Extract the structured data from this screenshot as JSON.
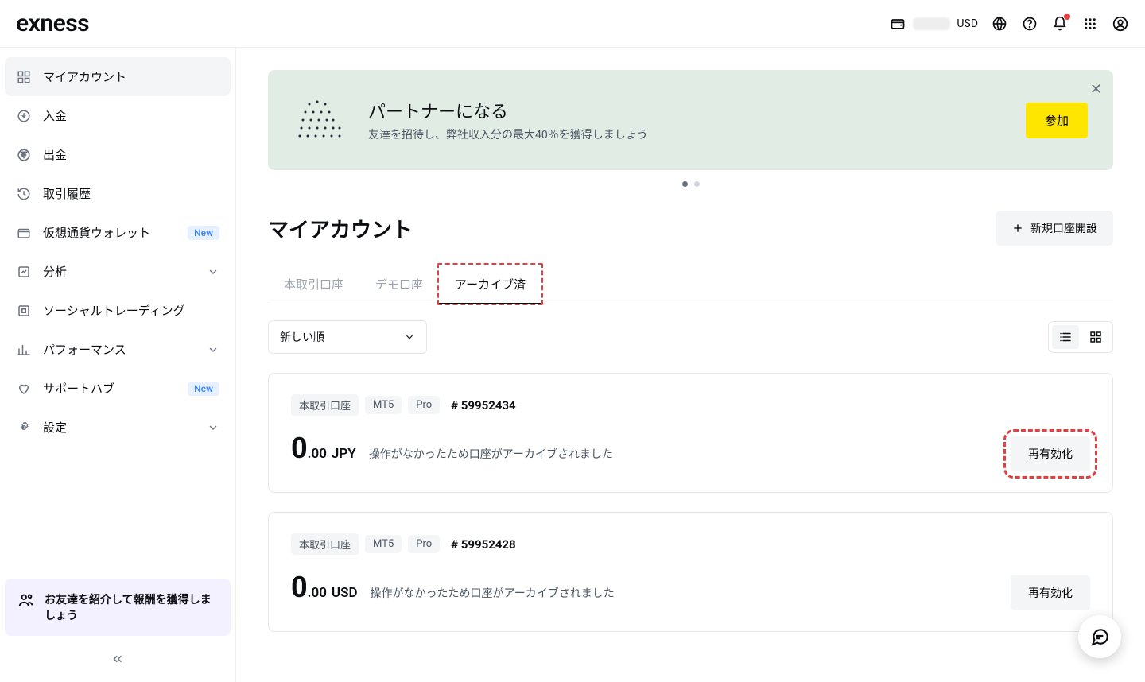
{
  "brand": "exness",
  "header": {
    "currency": "USD"
  },
  "sidebar": {
    "items": [
      {
        "label": "マイアカウント"
      },
      {
        "label": "入金"
      },
      {
        "label": "出金"
      },
      {
        "label": "取引履歴"
      },
      {
        "label": "仮想通貨ウォレット",
        "badge": "New"
      },
      {
        "label": "分析",
        "expandable": true
      },
      {
        "label": "ソーシャルトレーディング"
      },
      {
        "label": "パフォーマンス",
        "expandable": true
      },
      {
        "label": "サポートハブ",
        "badge": "New"
      },
      {
        "label": "設定",
        "expandable": true
      }
    ],
    "referral": "お友達を紹介して報酬を獲得しましょう"
  },
  "banner": {
    "title": "パートナーになる",
    "subtitle": "友達を招待し、弊社収入分の最大40％を獲得しましょう",
    "cta": "参加"
  },
  "page": {
    "title": "マイアカウント",
    "new_account": "新規口座開設"
  },
  "tabs": {
    "real": "本取引口座",
    "demo": "デモ口座",
    "archived": "アーカイブ済"
  },
  "sort": {
    "label": "新しい順"
  },
  "accounts": [
    {
      "type_label": "本取引口座",
      "platform": "MT5",
      "tier": "Pro",
      "number_prefix": "#",
      "number": "59952434",
      "balance_int": "0",
      "balance_dec": ".00",
      "currency": "JPY",
      "status": "操作がなかったため口座がアーカイブされました",
      "reactivate": "再有効化",
      "highlighted": true
    },
    {
      "type_label": "本取引口座",
      "platform": "MT5",
      "tier": "Pro",
      "number_prefix": "#",
      "number": "59952428",
      "balance_int": "0",
      "balance_dec": ".00",
      "currency": "USD",
      "status": "操作がなかったため口座がアーカイブされました",
      "reactivate": "再有効化",
      "highlighted": false
    }
  ]
}
